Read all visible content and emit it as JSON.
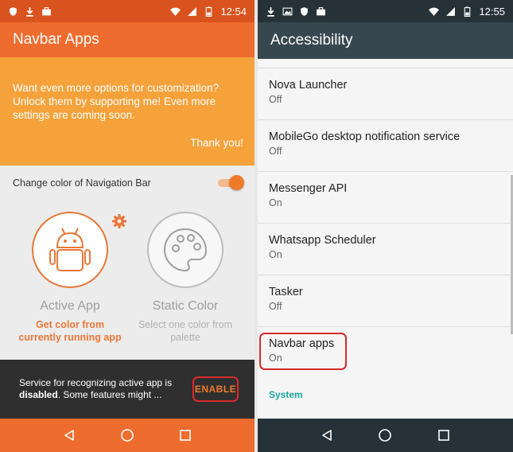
{
  "left": {
    "statusbar": {
      "time": "12:54"
    },
    "appbar": {
      "title": "Navbar Apps"
    },
    "promo": {
      "text": "Want even more options for customization? Unlock them by supporting me! Even more settings are coming soon.",
      "thanks": "Thank you!"
    },
    "setting": {
      "label": "Change color of Navigation Bar",
      "enabled": true
    },
    "choices": {
      "active": {
        "title": "Active App",
        "desc": "Get color from currently running app"
      },
      "static": {
        "title": "Static Color",
        "desc": "Select one color from palette"
      }
    },
    "service": {
      "text_pre": "Service for recognizing active app is ",
      "text_bold": "disabled",
      "text_post": ". Some features might ...",
      "button": "ENABLE"
    }
  },
  "right": {
    "statusbar": {
      "time": "12:55"
    },
    "appbar": {
      "title": "Accessibility"
    },
    "items": [
      {
        "title": "Nova Launcher",
        "status": "Off"
      },
      {
        "title": "MobileGo desktop notification service",
        "status": "Off"
      },
      {
        "title": "Messenger API",
        "status": "On"
      },
      {
        "title": "Whatsapp Scheduler",
        "status": "On"
      },
      {
        "title": "Tasker",
        "status": "Off"
      },
      {
        "title": "Navbar apps",
        "status": "On"
      }
    ],
    "section": "System"
  },
  "colors": {
    "orange_primary": "#ef6c2f",
    "orange_dark": "#d9531e",
    "promo": "#f5a23b",
    "slate": "#37474f",
    "slate_dark": "#263238",
    "teal": "#19a79b",
    "highlight_red": "#d82a2a"
  },
  "icons": [
    "download-icon",
    "image-icon",
    "briefcase-icon",
    "wifi-icon",
    "signal-icon",
    "battery-icon",
    "shield-icon",
    "android-icon",
    "palette-icon",
    "gear-icon",
    "back-icon",
    "home-icon",
    "recents-icon"
  ]
}
